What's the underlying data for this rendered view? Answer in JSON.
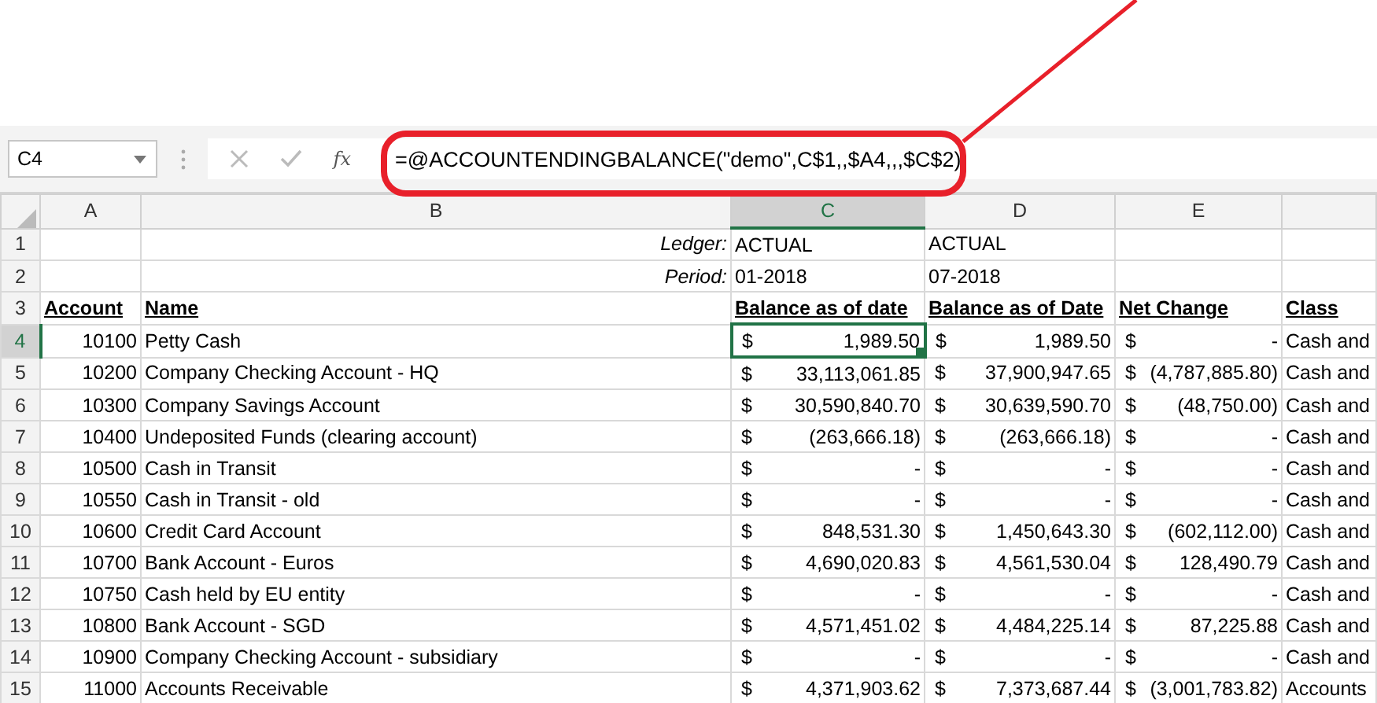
{
  "formula_bar": {
    "name_box": "C4",
    "function_label": "fx",
    "formula": "=@ACCOUNTENDINGBALANCE(\"demo\",C$1,,$A4,,,$C$2)"
  },
  "columns": [
    {
      "label": "A",
      "selected": false
    },
    {
      "label": "B",
      "selected": false
    },
    {
      "label": "C",
      "selected": true
    },
    {
      "label": "D",
      "selected": false
    },
    {
      "label": "E",
      "selected": false
    }
  ],
  "meta_rows": [
    {
      "num": "1",
      "label": "Ledger:",
      "c": "ACTUAL",
      "d": "ACTUAL"
    },
    {
      "num": "2",
      "label": "Period:",
      "c": "01-2018",
      "d": "07-2018"
    }
  ],
  "header_row": {
    "num": "3",
    "cells": [
      "Account",
      "Name",
      "Balance as of date",
      "Balance as of Date",
      "Net Change",
      "Class"
    ]
  },
  "rows": [
    {
      "num": "4",
      "selected": true,
      "account": "10100",
      "name": "Petty Cash",
      "amounts": [
        {
          "sign": "$",
          "amount": "1,989.50",
          "selected": true
        },
        {
          "sign": "$",
          "amount": "1,989.50",
          "selected": false
        },
        {
          "sign": "$",
          "amount": "-",
          "selected": false
        }
      ],
      "class": "Cash and"
    },
    {
      "num": "5",
      "selected": false,
      "account": "10200",
      "name": "Company Checking Account - HQ",
      "amounts": [
        {
          "sign": "$",
          "amount": "33,113,061.85",
          "selected": false
        },
        {
          "sign": "$",
          "amount": "37,900,947.65",
          "selected": false
        },
        {
          "sign": "$",
          "amount": "(4,787,885.80)",
          "selected": false
        }
      ],
      "class": "Cash and"
    },
    {
      "num": "6",
      "selected": false,
      "account": "10300",
      "name": "Company Savings Account",
      "amounts": [
        {
          "sign": "$",
          "amount": "30,590,840.70",
          "selected": false
        },
        {
          "sign": "$",
          "amount": "30,639,590.70",
          "selected": false
        },
        {
          "sign": "$",
          "amount": "(48,750.00)",
          "selected": false
        }
      ],
      "class": "Cash and"
    },
    {
      "num": "7",
      "selected": false,
      "account": "10400",
      "name": "Undeposited Funds (clearing account)",
      "amounts": [
        {
          "sign": "$",
          "amount": "(263,666.18)",
          "selected": false
        },
        {
          "sign": "$",
          "amount": "(263,666.18)",
          "selected": false
        },
        {
          "sign": "$",
          "amount": "-",
          "selected": false
        }
      ],
      "class": "Cash and"
    },
    {
      "num": "8",
      "selected": false,
      "account": "10500",
      "name": "Cash in Transit",
      "amounts": [
        {
          "sign": "$",
          "amount": "-",
          "selected": false
        },
        {
          "sign": "$",
          "amount": "-",
          "selected": false
        },
        {
          "sign": "$",
          "amount": "-",
          "selected": false
        }
      ],
      "class": "Cash and"
    },
    {
      "num": "9",
      "selected": false,
      "account": "10550",
      "name": "Cash in Transit - old",
      "amounts": [
        {
          "sign": "$",
          "amount": "-",
          "selected": false
        },
        {
          "sign": "$",
          "amount": "-",
          "selected": false
        },
        {
          "sign": "$",
          "amount": "-",
          "selected": false
        }
      ],
      "class": "Cash and"
    },
    {
      "num": "10",
      "selected": false,
      "account": "10600",
      "name": "Credit Card Account",
      "amounts": [
        {
          "sign": "$",
          "amount": "848,531.30",
          "selected": false
        },
        {
          "sign": "$",
          "amount": "1,450,643.30",
          "selected": false
        },
        {
          "sign": "$",
          "amount": "(602,112.00)",
          "selected": false
        }
      ],
      "class": "Cash and"
    },
    {
      "num": "11",
      "selected": false,
      "account": "10700",
      "name": "Bank Account - Euros",
      "amounts": [
        {
          "sign": "$",
          "amount": "4,690,020.83",
          "selected": false
        },
        {
          "sign": "$",
          "amount": "4,561,530.04",
          "selected": false
        },
        {
          "sign": "$",
          "amount": "128,490.79",
          "selected": false
        }
      ],
      "class": "Cash and"
    },
    {
      "num": "12",
      "selected": false,
      "account": "10750",
      "name": "Cash held by EU entity",
      "amounts": [
        {
          "sign": "$",
          "amount": "-",
          "selected": false
        },
        {
          "sign": "$",
          "amount": "-",
          "selected": false
        },
        {
          "sign": "$",
          "amount": "-",
          "selected": false
        }
      ],
      "class": "Cash and"
    },
    {
      "num": "13",
      "selected": false,
      "account": "10800",
      "name": "Bank Account - SGD",
      "amounts": [
        {
          "sign": "$",
          "amount": "4,571,451.02",
          "selected": false
        },
        {
          "sign": "$",
          "amount": "4,484,225.14",
          "selected": false
        },
        {
          "sign": "$",
          "amount": "87,225.88",
          "selected": false
        }
      ],
      "class": "Cash and"
    },
    {
      "num": "14",
      "selected": false,
      "account": "10900",
      "name": "Company Checking Account - subsidiary",
      "amounts": [
        {
          "sign": "$",
          "amount": "-",
          "selected": false
        },
        {
          "sign": "$",
          "amount": "-",
          "selected": false
        },
        {
          "sign": "$",
          "amount": "-",
          "selected": false
        }
      ],
      "class": "Cash and"
    },
    {
      "num": "15",
      "selected": false,
      "account": "11000",
      "name": "Accounts Receivable",
      "amounts": [
        {
          "sign": "$",
          "amount": "4,371,903.62",
          "selected": false
        },
        {
          "sign": "$",
          "amount": "7,373,687.44",
          "selected": false
        },
        {
          "sign": "$",
          "amount": "(3,001,783.82)",
          "selected": false
        }
      ],
      "class": "Accounts"
    }
  ]
}
